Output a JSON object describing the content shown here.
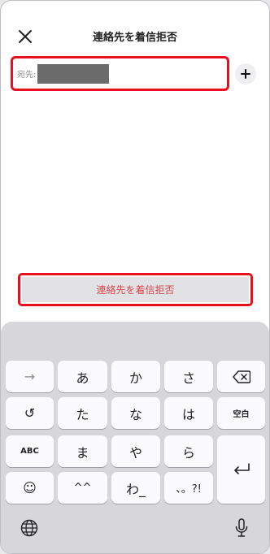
{
  "header": {
    "title": "連絡先を着信拒否",
    "close_icon": "close-icon"
  },
  "to_field": {
    "label": "宛先:",
    "value_redacted": true
  },
  "add_button": {
    "icon": "plus-icon"
  },
  "block_button": {
    "label": "連絡先を着信拒否"
  },
  "keyboard": {
    "rows": [
      [
        "→",
        "あ",
        "か",
        "さ",
        "⌫"
      ],
      [
        "↺",
        "た",
        "な",
        "は",
        "空白"
      ],
      [
        "ABC",
        "ま",
        "や",
        "ら",
        "↵"
      ],
      [
        "☺",
        "^^",
        "わ_",
        "、。?!"
      ]
    ],
    "row1": {
      "arrow": "→",
      "a": "あ",
      "ka": "か",
      "sa": "さ"
    },
    "row2": {
      "undo": "↺",
      "ta": "た",
      "na": "な",
      "ha": "は",
      "space": "空白"
    },
    "row3": {
      "abc": "ABC",
      "ma": "ま",
      "ya": "や",
      "ra": "ら"
    },
    "row4": {
      "emoji": "☺",
      "kaomoji": "^^",
      "wa": "わ_",
      "punct": "、。?!"
    },
    "icons": [
      "delete-icon",
      "return-icon",
      "globe-icon",
      "microphone-icon"
    ]
  },
  "colors": {
    "accent_red": "#e8101e",
    "block_text": "#d9444a",
    "keyboard_bg": "#d6d6db"
  }
}
